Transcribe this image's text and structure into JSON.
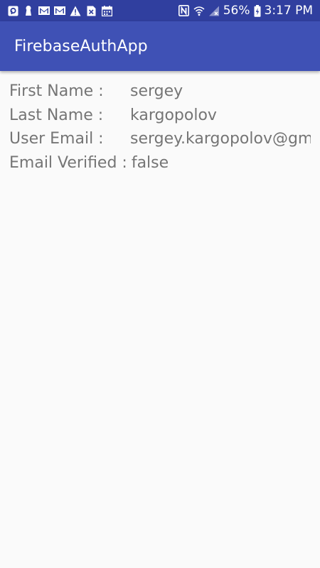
{
  "status_bar": {
    "battery_percent": "56%",
    "time": "3:17 PM",
    "background_color": "#303f9f",
    "left_icons": [
      "pocket-icon",
      "keyhole-icon",
      "gmail-icon",
      "gmail-icon",
      "warning-icon",
      "close-box-icon",
      "calendar-icon"
    ],
    "right_icons": [
      "nfc-icon",
      "wifi-icon",
      "signal-icon",
      "battery-charging-icon"
    ]
  },
  "app_bar": {
    "title": "FirebaseAuthApp",
    "background_color": "#3f51b5"
  },
  "profile": {
    "rows": [
      {
        "label": "First Name :",
        "value": "sergey"
      },
      {
        "label": "Last Name :",
        "value": "kargopolov"
      },
      {
        "label": "User Email :",
        "value": "sergey.kargopolov@gm"
      },
      {
        "label": "Email Verified :",
        "value": "false"
      }
    ]
  }
}
